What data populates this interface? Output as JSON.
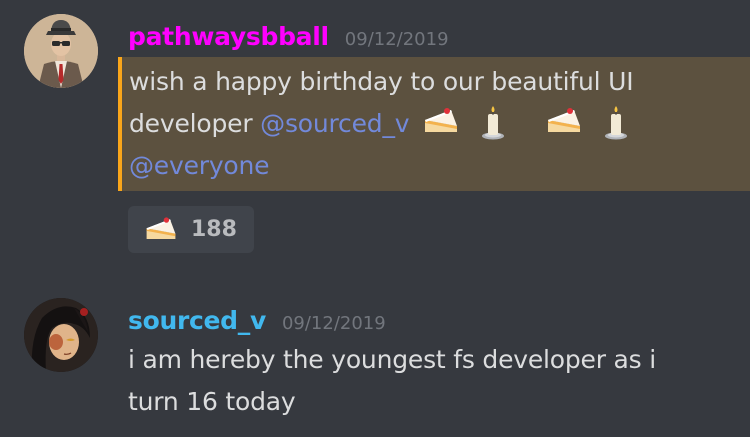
{
  "messages": [
    {
      "author": "pathwaysbball",
      "author_color": "#ff00ff",
      "timestamp": "09/12/2019",
      "avatar_icon": "man-in-suit-hat-sunglasses-avatar",
      "highlighted": true,
      "lines": [
        {
          "text": "wish a happy birthday to our beautiful UI"
        },
        {
          "text": "developer ",
          "mention": "@sourced_v",
          "emojis": [
            "cake",
            "candle",
            "cake",
            "candle"
          ]
        },
        {
          "mention": "@everyone"
        }
      ],
      "reactions": [
        {
          "emoji": "cake",
          "count": "188"
        }
      ]
    },
    {
      "author": "sourced_v",
      "author_color": "#41b8ee",
      "timestamp": "09/12/2019",
      "avatar_icon": "dark-haired-anime-character-avatar",
      "highlighted": false,
      "lines": [
        {
          "text": "i am hereby the youngest fs developer as i"
        },
        {
          "text": "turn 16 today"
        }
      ]
    }
  ],
  "colors": {
    "background": "#36393f",
    "mention_highlight": "#5c513f",
    "mention_border": "#faa61a",
    "mention_text": "#7289da",
    "reaction_bg": "#40444b"
  }
}
